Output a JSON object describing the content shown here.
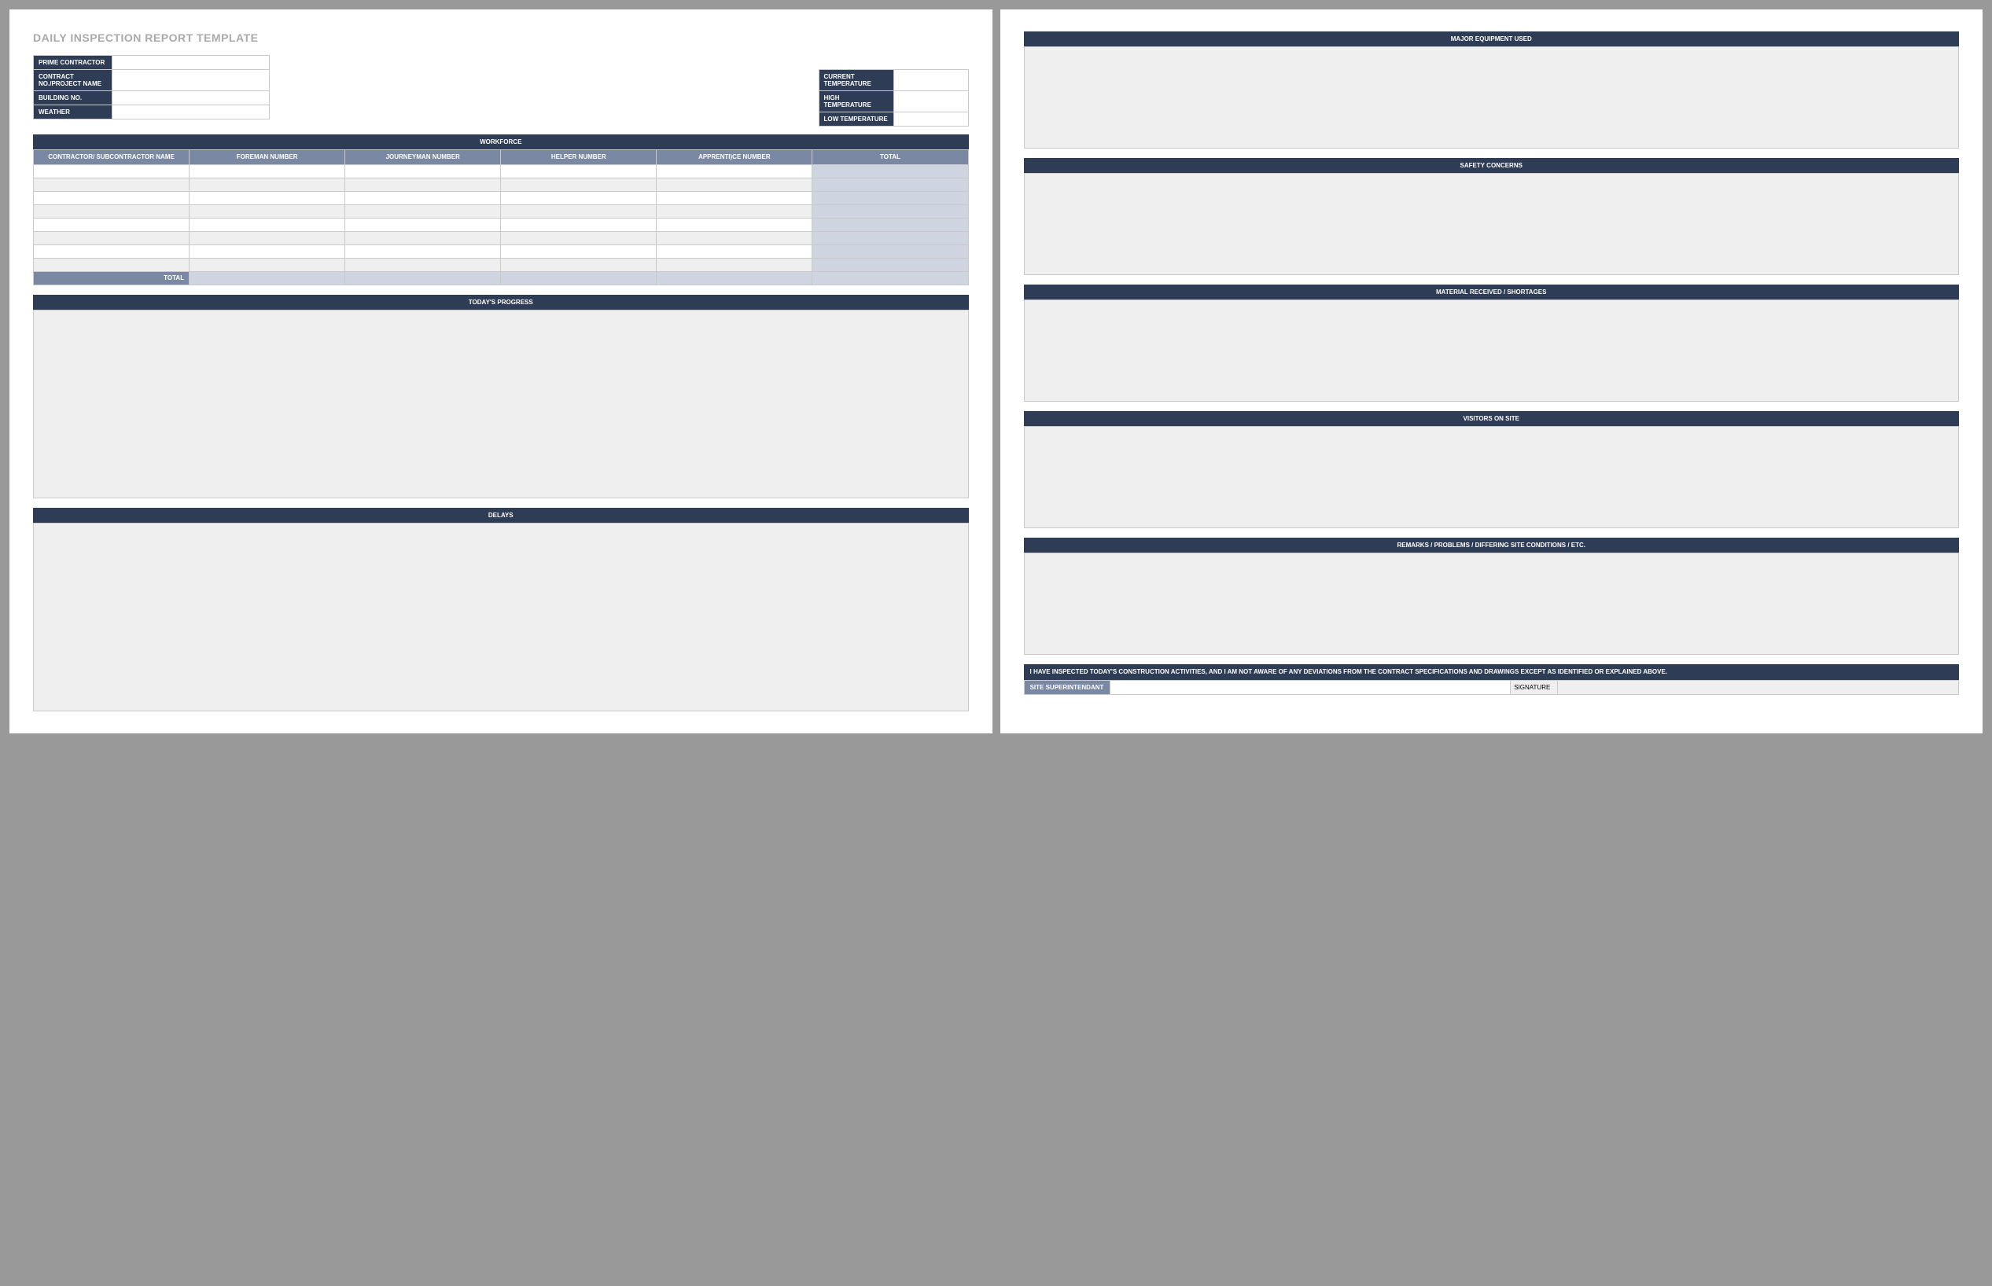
{
  "title": "DAILY INSPECTION REPORT TEMPLATE",
  "left_meta": {
    "prime_contractor_label": "PRIME CONTRACTOR",
    "contract_no_label": "CONTRACT NO./PROJECT NAME",
    "building_no_label": "BUILDING NO.",
    "weather_label": "WEATHER"
  },
  "right_meta": {
    "current_temp_label": "CURRENT TEMPERATURE",
    "high_temp_label": "HIGH TEMPERATURE",
    "low_temp_label": "LOW TEMPERATURE"
  },
  "workforce": {
    "header": "WORKFORCE",
    "cols": {
      "contractor": "CONTRACTOR/\nSUBCONTRACTOR NAME",
      "foreman": "FOREMAN NUMBER",
      "journeyman": "JOURNEYMAN NUMBER",
      "helper": "HELPER NUMBER",
      "apprentice": "APPRENTI)CE NUMBER",
      "total": "TOTAL"
    },
    "total_label": "TOTAL"
  },
  "sections": {
    "progress": "TODAY'S PROGRESS",
    "delays": "DELAYS",
    "equipment": "MAJOR EQUIPMENT USED",
    "safety": "SAFETY CONCERNS",
    "material": "MATERIAL RECEIVED / SHORTAGES",
    "visitors": "VISITORS ON SITE",
    "remarks": "REMARKS / PROBLEMS / DIFFERING SITE CONDITIONS / ETC."
  },
  "attestation": "I HAVE INSPECTED TODAY'S CONSTRUCTION ACTIVITIES, AND I AM NOT AWARE OF ANY DEVIATIONS FROM THE CONTRACT SPECIFICATIONS AND DRAWINGS EXCEPT AS IDENTIFIED OR EXPLAINED ABOVE.",
  "signature": {
    "role_label": "SITE SUPERINTENDANT",
    "sig_label": "SIGNATURE"
  }
}
